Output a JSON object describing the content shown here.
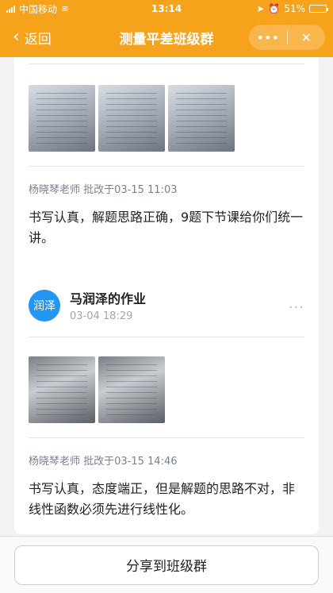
{
  "status_bar": {
    "carrier": "中国移动",
    "time": "13:14",
    "battery": "51%",
    "battery_level": 0.51
  },
  "nav": {
    "back_label": "返回",
    "title": "测量平差班级群",
    "more_icon": "more-icon",
    "close_icon": "close-icon"
  },
  "cards": [
    {
      "images": [
        "homework-image",
        "homework-image",
        "homework-image"
      ],
      "comment_meta": "杨晓琴老师 批改于03-15 11:03",
      "comment_text": "书写认真，解题思路正确，9题下节课给你们统一讲。"
    },
    {
      "avatar_text": "润泽",
      "title": "马润泽的作业",
      "date": "03-04 18:29",
      "images": [
        "homework-image",
        "homework-image"
      ],
      "comment_meta": "杨晓琴老师 批改于03-15 14:46",
      "comment_text": "书写认真，态度端正，但是解题的思路不对，非线性函数必须先进行线性化。"
    }
  ],
  "bottom": {
    "share_label": "分享到班级群"
  },
  "colors": {
    "accent": "#f7a21b",
    "avatar": "#2196f3"
  }
}
